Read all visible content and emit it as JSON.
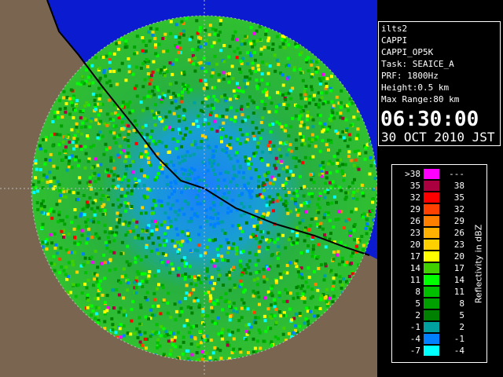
{
  "info": {
    "lines": [
      "ilts2",
      "CAPPI",
      "CAPPI_OP5K",
      "Task: SEAICE_A",
      "PRF: 1800Hz",
      "Height:0.5 km",
      "Max Range:80 km"
    ],
    "time": "06:30:00",
    "date": "30 OCT 2010 JST"
  },
  "legend": {
    "unit_label": "Reflectivity in dBZ",
    "rows": [
      {
        "lo": ">38",
        "hi": "---",
        "color": "#ff00ff"
      },
      {
        "lo": "35",
        "hi": "38",
        "color": "#aa0040"
      },
      {
        "lo": "32",
        "hi": "35",
        "color": "#ff0000"
      },
      {
        "lo": "29",
        "hi": "32",
        "color": "#ff4000"
      },
      {
        "lo": "26",
        "hi": "29",
        "color": "#ff8000"
      },
      {
        "lo": "23",
        "hi": "26",
        "color": "#ffb000"
      },
      {
        "lo": "20",
        "hi": "23",
        "color": "#ffd000"
      },
      {
        "lo": "17",
        "hi": "20",
        "color": "#ffff00"
      },
      {
        "lo": "14",
        "hi": "17",
        "color": "#40d000"
      },
      {
        "lo": "11",
        "hi": "14",
        "color": "#00ff00"
      },
      {
        "lo": "8",
        "hi": "11",
        "color": "#00c000"
      },
      {
        "lo": "5",
        "hi": "8",
        "color": "#00a000"
      },
      {
        "lo": "2",
        "hi": "5",
        "color": "#008000"
      },
      {
        "lo": "-1",
        "hi": "2",
        "color": "#00a0a0"
      },
      {
        "lo": "-4",
        "hi": "-1",
        "color": "#0080ff"
      },
      {
        "lo": "-7",
        "hi": "-4",
        "color": "#00ffff"
      }
    ]
  },
  "map": {
    "sea_color": "#0a1bd0",
    "land_color": "#7a6650",
    "coast_color": "#000000",
    "range_ring_color": "#cccccc",
    "river_color": "#6060ff"
  }
}
